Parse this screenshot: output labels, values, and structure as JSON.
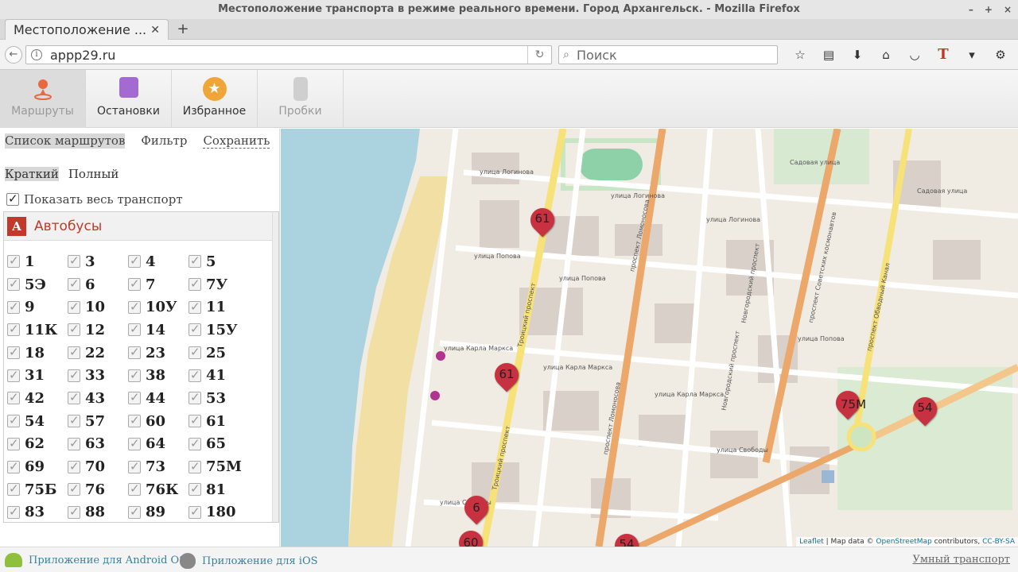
{
  "window": {
    "title": "Местоположение транспорта в режиме реального времени. Город Архангельск. - Mozilla Firefox",
    "tab_label": "Местоположение ...",
    "url": "appp29.ru",
    "search_placeholder": "Поиск"
  },
  "header": {
    "tabs": [
      {
        "label": "Маршруты",
        "icon": "route-pin-icon"
      },
      {
        "label": "Остановки",
        "icon": "bus-stop-icon"
      },
      {
        "label": "Избранное",
        "icon": "star-icon"
      },
      {
        "label": "Пробки",
        "icon": "traffic-light-icon"
      }
    ]
  },
  "panel": {
    "tabs": [
      "Список маршрутов",
      "Фильтр",
      "Сохранить"
    ],
    "views": [
      "Краткий",
      "Полный"
    ],
    "show_all_label": "Показать весь транспорт",
    "bus_badge": "А",
    "bus_title": "Автобусы",
    "routes": [
      "1",
      "3",
      "4",
      "5",
      "5Э",
      "6",
      "7",
      "7У",
      "9",
      "10",
      "10У",
      "11",
      "11К",
      "12",
      "14",
      "15У",
      "18",
      "22",
      "23",
      "25",
      "31",
      "33",
      "38",
      "41",
      "42",
      "43",
      "44",
      "53",
      "54",
      "57",
      "60",
      "61",
      "62",
      "63",
      "64",
      "65",
      "69",
      "70",
      "73",
      "75М",
      "75Б",
      "76",
      "76К",
      "81",
      "83",
      "88",
      "89",
      "180"
    ]
  },
  "map": {
    "streets": [
      "улица Логинова",
      "улица Логинова",
      "улица Логинова",
      "Садовая улица",
      "Садовая улица",
      "улица Попова",
      "улица Попова",
      "улица Попова",
      "улица Карла Маркса",
      "улица Карла Маркса",
      "улица Карла Маркса",
      "улица Свободы",
      "улица Свободы",
      "Троицкий проспект",
      "Троицкий проспект",
      "проспект Ломоносова",
      "проспект Ломоносова",
      "проспект Советских космонавтов",
      "проспект Обводный Канал",
      "Новгородский проспект",
      "Новгородский проспект"
    ],
    "markers": [
      "61",
      "61",
      "6",
      "75М",
      "54",
      "60",
      "54"
    ],
    "attribution": {
      "leaflet": "Leaflet",
      "sep1": " | Map data © ",
      "osm": "OpenStreetMap",
      "sep2": " contributors, ",
      "license": "CC-BY-SA"
    }
  },
  "footer": {
    "android": "Приложение для Android OS",
    "ios": "Приложение для iOS",
    "smart": "Умный транспорт"
  }
}
